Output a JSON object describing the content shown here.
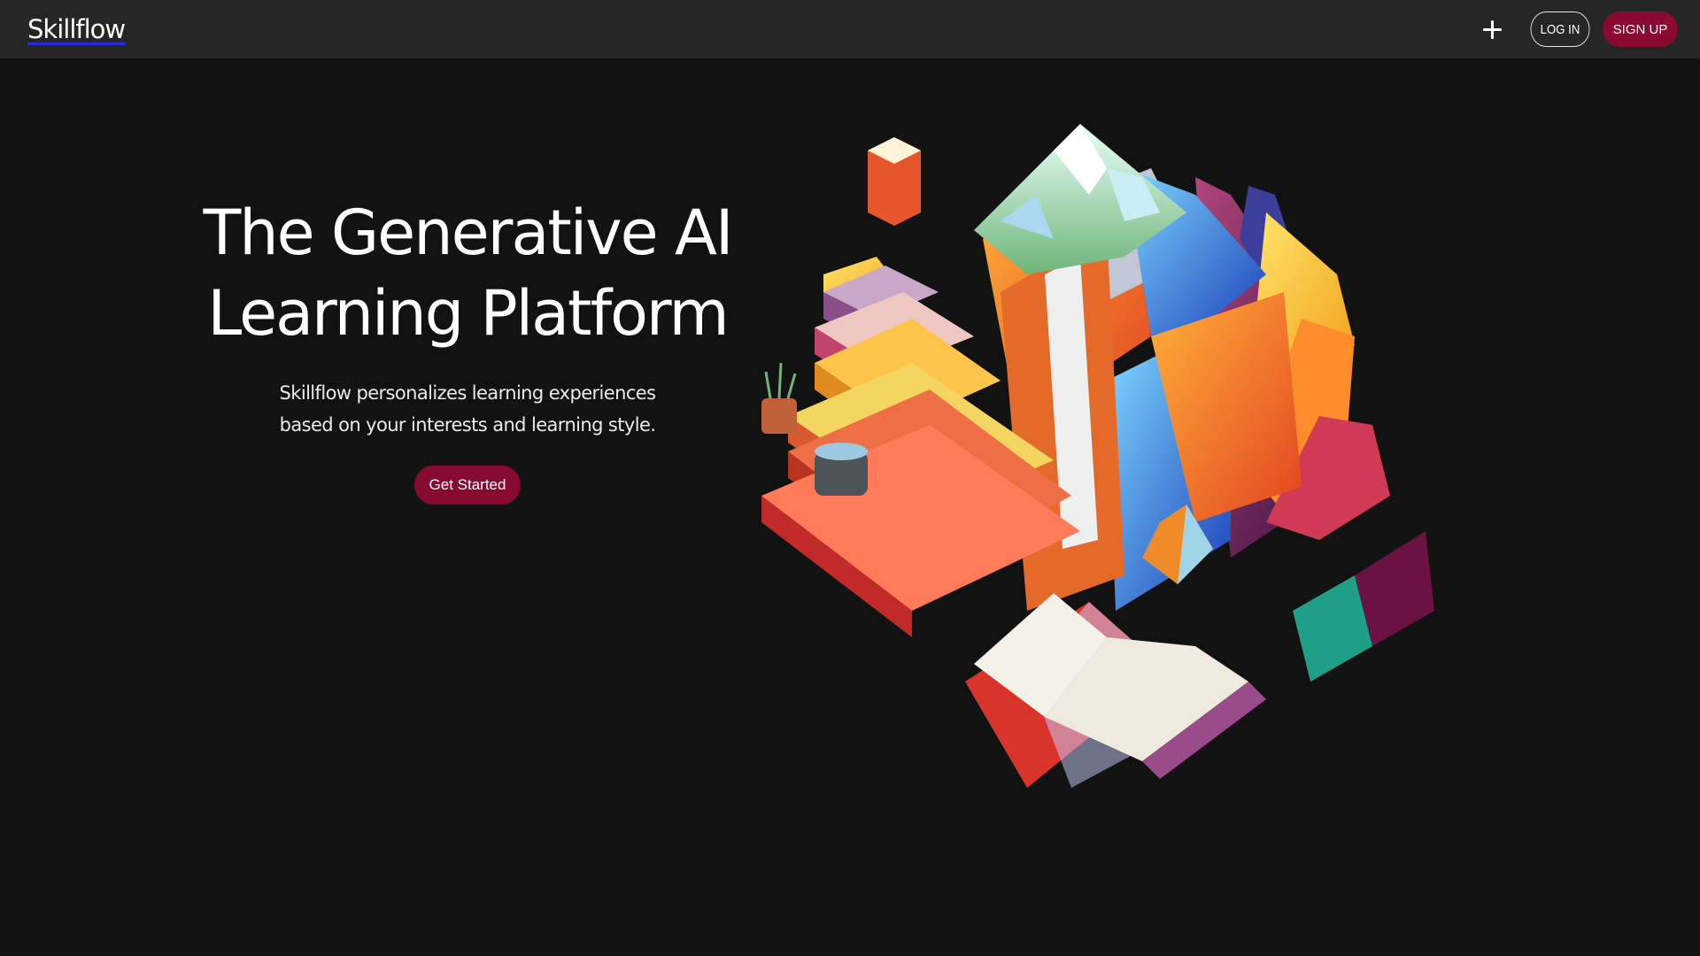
{
  "navbar": {
    "brand": "Skillflow",
    "login_label": "LOG IN",
    "signup_label": "SIGN UP"
  },
  "hero": {
    "title_line1": "The Generative AI",
    "title_line2": "Learning Platform",
    "subtitle_line1": "Skillflow personalizes learning experiences",
    "subtitle_line2": "based on your interests and learning style.",
    "cta_label": "Get Started"
  },
  "icons": {
    "add": "plus-icon"
  },
  "colors": {
    "background": "#121212",
    "navbar": "#262626",
    "accent": "#8a0a31",
    "text": "#ffffff"
  }
}
